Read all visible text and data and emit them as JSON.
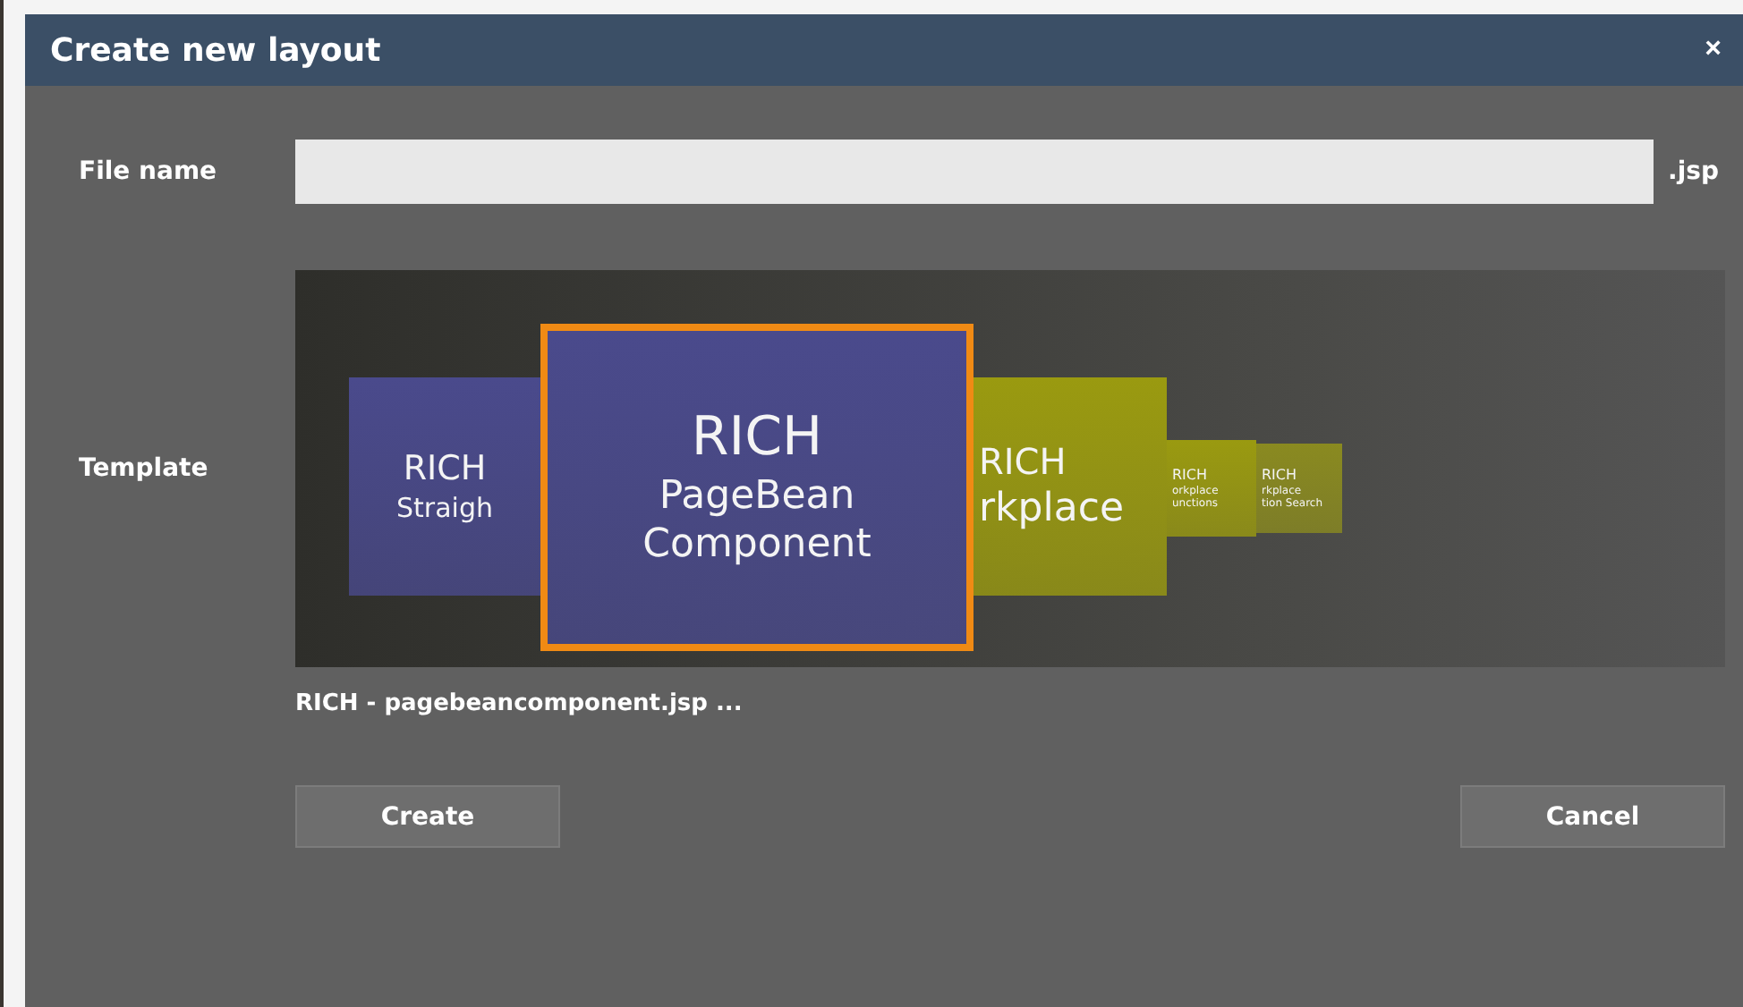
{
  "window": {
    "title": "Create new layout",
    "close": "×"
  },
  "file_name": {
    "label": "File name",
    "suffix": ".jsp"
  },
  "template": {
    "label": "Template",
    "caption": "RICH - pagebeancomponent.jsp ...",
    "slides": [
      {
        "kind": "side",
        "lines": [
          "RICH",
          "Straigh"
        ],
        "color": "#4a4a8c",
        "selected": false
      },
      {
        "kind": "main",
        "lines": [
          "RICH",
          "PageBean",
          "Component"
        ],
        "color": "#4a4a8c",
        "selected": true
      },
      {
        "kind": "side",
        "lines": [
          "RICH",
          "rkplace"
        ],
        "color": "#9a9a10",
        "selected": false
      },
      {
        "kind": "small",
        "lines": [
          "RICH",
          "orkplace",
          "unctions"
        ],
        "color": "#9a9a10",
        "selected": false
      },
      {
        "kind": "small",
        "lines": [
          "RICH",
          "rkplace",
          "tion Search"
        ],
        "color": "#8a8a20",
        "selected": false
      }
    ]
  },
  "buttons": [
    {
      "label": "Create"
    },
    {
      "label": "Cancel"
    }
  ]
}
